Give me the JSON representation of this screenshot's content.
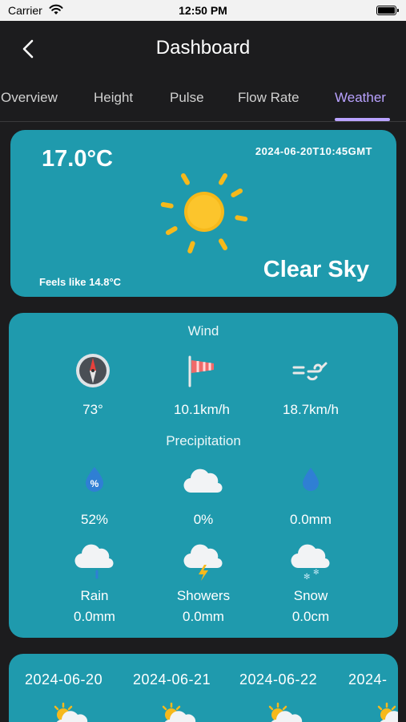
{
  "status_bar": {
    "carrier": "Carrier",
    "time": "12:50 PM"
  },
  "nav": {
    "title": "Dashboard"
  },
  "tabs": [
    {
      "label": "Overview"
    },
    {
      "label": "Height"
    },
    {
      "label": "Pulse"
    },
    {
      "label": "Flow Rate"
    },
    {
      "label": "Weather",
      "active": true
    }
  ],
  "current": {
    "temperature": "17.0°C",
    "timestamp": "2024-06-20T10:45GMT",
    "condition": "Clear Sky",
    "feels_like": "Feels like 14.8°C",
    "icon": "sun-icon"
  },
  "wind": {
    "title": "Wind",
    "items": [
      {
        "icon": "compass-icon",
        "value": "73°"
      },
      {
        "icon": "windsock-icon",
        "value": "10.1km/h"
      },
      {
        "icon": "wind-gust-icon",
        "value": "18.7km/h"
      }
    ]
  },
  "precipitation": {
    "title": "Precipitation",
    "items": [
      {
        "icon": "probability-drop-icon",
        "value": "52%"
      },
      {
        "icon": "cloud-icon",
        "value": "0%"
      },
      {
        "icon": "raindrop-icon",
        "value": "0.0mm"
      }
    ],
    "types": [
      {
        "icon": "rain-cloud-icon",
        "label": "Rain",
        "value": "0.0mm"
      },
      {
        "icon": "thunder-cloud-icon",
        "label": "Showers",
        "value": "0.0mm"
      },
      {
        "icon": "snow-cloud-icon",
        "label": "Snow",
        "value": "0.0cm"
      }
    ]
  },
  "forecast": {
    "days": [
      {
        "date": "2024-06-20",
        "icon": "partly-cloudy-icon"
      },
      {
        "date": "2024-06-21",
        "icon": "partly-cloudy-icon"
      },
      {
        "date": "2024-06-22",
        "icon": "partly-cloudy-icon"
      },
      {
        "date": "2024-",
        "icon": "partly-cloudy-icon"
      }
    ]
  },
  "colors": {
    "background": "#1c1c1e",
    "card": "#1f9aad",
    "accent": "#b9a2ff",
    "sun": "#f6b91b"
  }
}
